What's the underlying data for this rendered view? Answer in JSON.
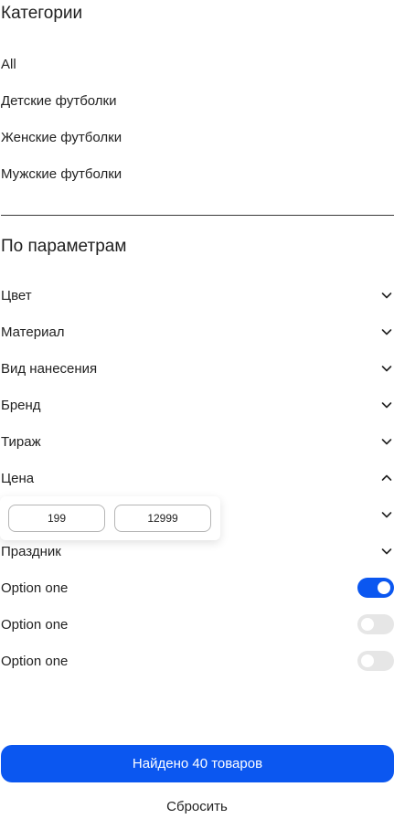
{
  "categories": {
    "title": "Категории",
    "items": [
      "All",
      "Детские футболки",
      "Женские футболки",
      "Мужские футболки"
    ]
  },
  "params": {
    "title": "По параметрам",
    "items": [
      {
        "label": "Цвет",
        "state": "collapsed"
      },
      {
        "label": "Материал",
        "state": "collapsed"
      },
      {
        "label": "Вид нанесения",
        "state": "collapsed"
      },
      {
        "label": "Бренд",
        "state": "collapsed"
      },
      {
        "label": "Тираж",
        "state": "collapsed"
      },
      {
        "label": "Цена",
        "state": "expanded"
      },
      {
        "label": "",
        "state": "collapsed"
      },
      {
        "label": "Праздник",
        "state": "collapsed"
      }
    ],
    "price": {
      "min": "199",
      "max": "12999"
    }
  },
  "options": [
    {
      "label": "Option one",
      "on": true
    },
    {
      "label": "Option one",
      "on": false
    },
    {
      "label": "Option one",
      "on": false
    }
  ],
  "footer": {
    "found_label": "Найдено 40 товаров",
    "reset_label": "Сбросить"
  },
  "colors": {
    "accent": "#0b57f0",
    "toggle_off": "#e6e6e6"
  },
  "icons": {
    "collapsed": "chevron-down-icon",
    "expanded": "chevron-up-icon"
  }
}
